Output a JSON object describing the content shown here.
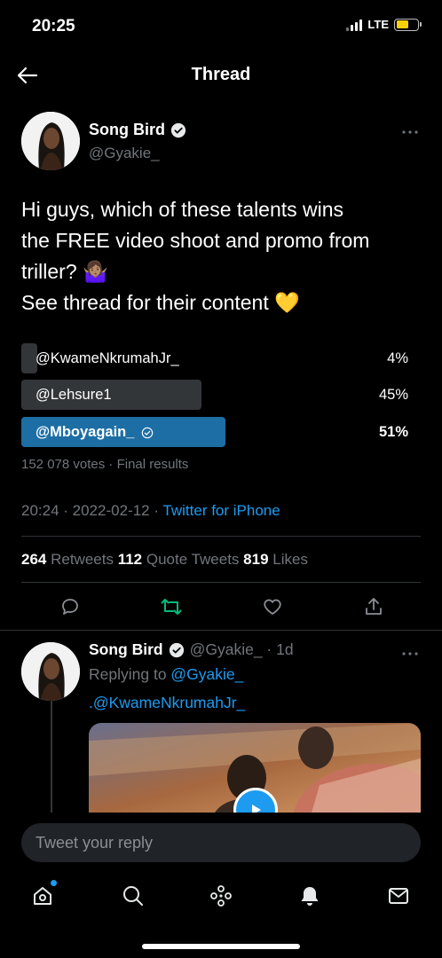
{
  "status_bar": {
    "time": "20:25",
    "network": "LTE",
    "battery_color": "#f5d10c"
  },
  "header": {
    "title": "Thread"
  },
  "tweet": {
    "author": {
      "name": "Song Bird",
      "handle": "@Gyakie_"
    },
    "text_lines": [
      "Hi guys, which of these talents wins",
      "the FREE video shoot and promo from",
      "triller? 🤷🏽‍♀️",
      "See thread for their content 💛"
    ],
    "poll": {
      "options": [
        {
          "label": "@KwameNkrumahJr_",
          "percent": "4%",
          "fraction": 0.04,
          "winner": false
        },
        {
          "label": "@Lehsure1",
          "percent": "45%",
          "fraction": 0.45,
          "winner": false
        },
        {
          "label": "@Mboyagain_",
          "percent": "51%",
          "fraction": 0.51,
          "winner": true
        }
      ],
      "meta": "152 078 votes · Final results"
    },
    "timestamp": "20:24 · 2022-02-12 · ",
    "source": "Twitter for iPhone",
    "stats": {
      "retweets_count": "264",
      "retweets_label": " Retweets  ",
      "quotes_count": "112",
      "quotes_label": " Quote Tweets  ",
      "likes_count": "819",
      "likes_label": " Likes"
    }
  },
  "reply": {
    "author_name": "Song Bird",
    "handle_time": "@Gyakie_ · 1d",
    "replying_prefix": "Replying to ",
    "replying_handle": "@Gyakie_",
    "body": ".@KwameNkrumahJr_"
  },
  "composer": {
    "placeholder": "Tweet your reply"
  },
  "colors": {
    "accent": "#1d9bf0",
    "poll_winner": "#1d6ea4",
    "poll_other": "#333639",
    "retweet_green": "#00ba7c"
  }
}
